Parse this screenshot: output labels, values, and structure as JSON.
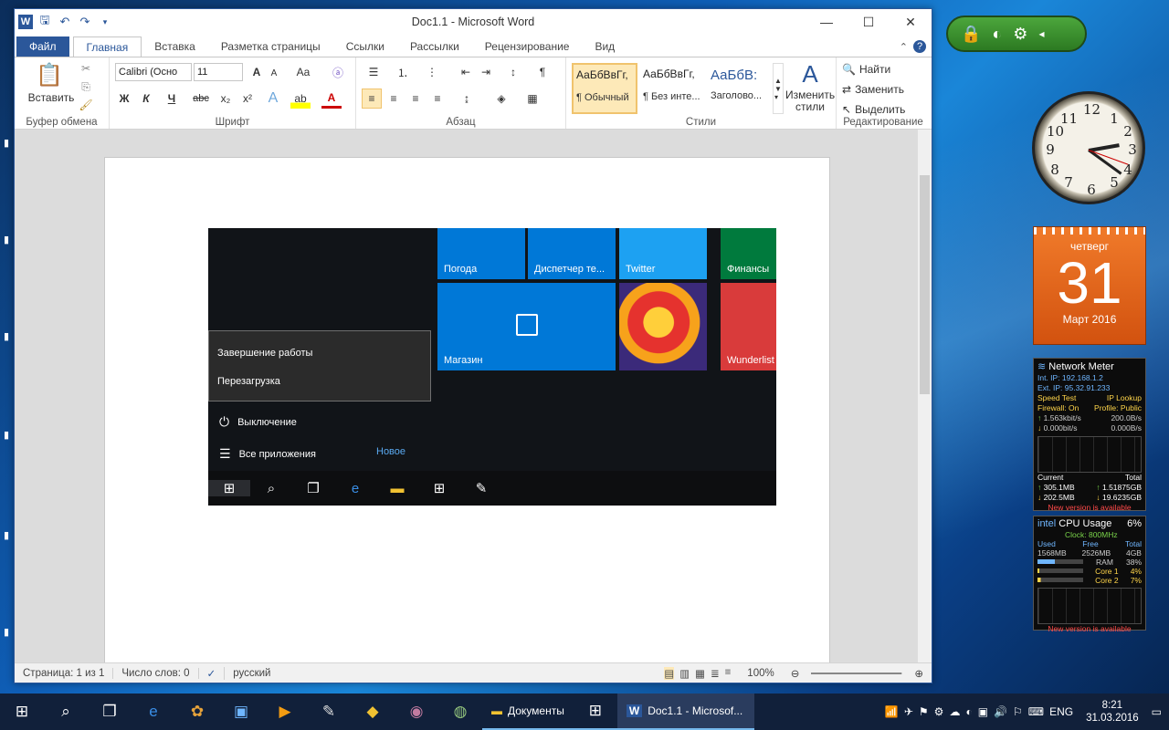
{
  "window": {
    "title": "Doc1.1  -  Microsoft Word",
    "controls": {
      "minimize": "—",
      "maximize": "☐",
      "close": "✕"
    }
  },
  "ribbon_tabs": [
    "Файл",
    "Главная",
    "Вставка",
    "Разметка страницы",
    "Ссылки",
    "Рассылки",
    "Рецензирование",
    "Вид"
  ],
  "ribbon": {
    "clipboard": {
      "paste_label": "Вставить",
      "group_label": "Буфер обмена"
    },
    "font": {
      "name": "Calibri (Осно",
      "size": "11",
      "bold": "Ж",
      "italic": "К",
      "underline": "Ч",
      "strike": "abc",
      "subscript": "x₂",
      "superscript": "x²",
      "case": "Aa",
      "group_label": "Шрифт"
    },
    "paragraph": {
      "group_label": "Абзац"
    },
    "styles": {
      "items": [
        {
          "sample": "АаБбВвГг,",
          "name": "¶ Обычный"
        },
        {
          "sample": "АаБбВвГг,",
          "name": "¶ Без инте..."
        },
        {
          "sample": "АаБбВ:",
          "name": "Заголово..."
        }
      ],
      "change_label": "Изменить\nстили",
      "group_label": "Стили"
    },
    "editing": {
      "find": "Найти",
      "replace": "Заменить",
      "select": "Выделить",
      "group_label": "Редактирование"
    }
  },
  "embedded_screenshot": {
    "tiles": [
      "Погода",
      "Диспетчер те...",
      "Twitter",
      "Финансы",
      "Магазин",
      "Wunderlist"
    ],
    "context_menu": [
      "Завершение работы",
      "Перезагрузка"
    ],
    "start_items": {
      "power": "Выключение",
      "all_apps": "Все приложения",
      "new": "Новое"
    }
  },
  "statusbar": {
    "page": "Страница: 1 из 1",
    "words": "Число слов: 0",
    "language": "русский",
    "zoom": "100%"
  },
  "gadgets": {
    "calendar": {
      "weekday": "четверг",
      "day": "31",
      "month": "Март 2016"
    },
    "network": {
      "title": "Network Meter",
      "int_ip": "Int. IP: 192.168.1.2",
      "ext_ip": "Ext. IP: 95.32.91.233",
      "speed_test": "Speed Test",
      "ip_lookup": "IP Lookup",
      "firewall": "Firewall: On",
      "profile": "Profile: Public",
      "up_rate": "1.563kbit/s",
      "up_rate2": "200.0B/s",
      "down_rate": "0.000bit/s",
      "down_rate2": "0.000B/s",
      "current": "Current",
      "total": "Total",
      "cur_up": "305.1MB",
      "cur_down": "202.5MB",
      "tot_up": "1.51875GB",
      "tot_down": "19.6235GB",
      "new_version": "New version is available"
    },
    "cpu": {
      "title": "CPU Usage",
      "percent": "6%",
      "clock": "Clock: 800MHz",
      "used_h": "Used",
      "free_h": "Free",
      "total_h": "Total",
      "used": "1568MB",
      "free": "2526MB",
      "total": "4GB",
      "ram": "RAM",
      "ram_pct": "38%",
      "core1": "Core 1",
      "core1_pct": "4%",
      "core2": "Core 2",
      "core2_pct": "7%",
      "new_version": "New version is available"
    }
  },
  "taskbar": {
    "documents": "Документы",
    "word": "Doc1.1 - Microsof...",
    "lang": "ENG",
    "time": "8:21",
    "date": "31.03.2016"
  }
}
